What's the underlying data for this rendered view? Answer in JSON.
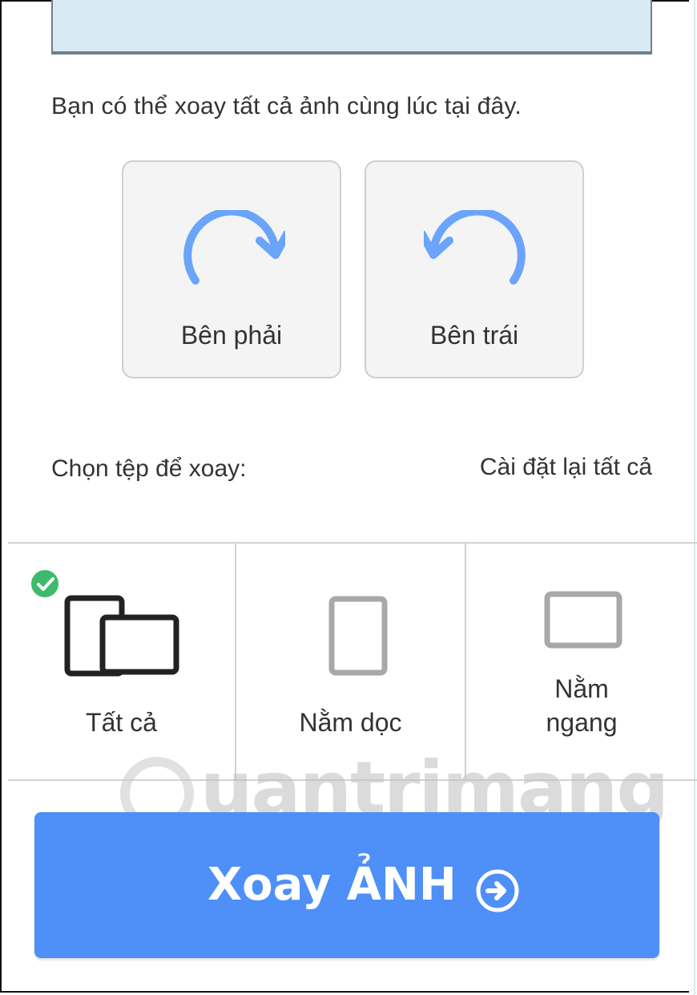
{
  "info_text": "Bạn có thể xoay tất cả ảnh cùng lúc tại đây.",
  "rotate_buttons": {
    "right_label": "Bên phải",
    "left_label": "Bên trái",
    "right_icon": "rotate-clockwise-icon",
    "left_icon": "rotate-counterclockwise-icon"
  },
  "choose_label": "Chọn tệp để xoay:",
  "reset_label": "Cài đặt lại tất cả",
  "filter_options": [
    {
      "label": "Tất cả",
      "icon": "all-orientations-icon",
      "selected": true
    },
    {
      "label": "Nằm dọc",
      "icon": "portrait-icon",
      "selected": false
    },
    {
      "label_line1": "Nằm",
      "label_line2": "ngang",
      "icon": "landscape-icon",
      "selected": false
    }
  ],
  "watermark": "uantrimang",
  "cta": {
    "label": "Xoay ẢNH",
    "icon": "arrow-right-circle-icon"
  },
  "colors": {
    "accent_blue": "#4e8ff8",
    "rotate_icon_blue": "#6aa4fb",
    "check_green": "#3dbb6a",
    "preview_bg": "#d9eaf4"
  }
}
